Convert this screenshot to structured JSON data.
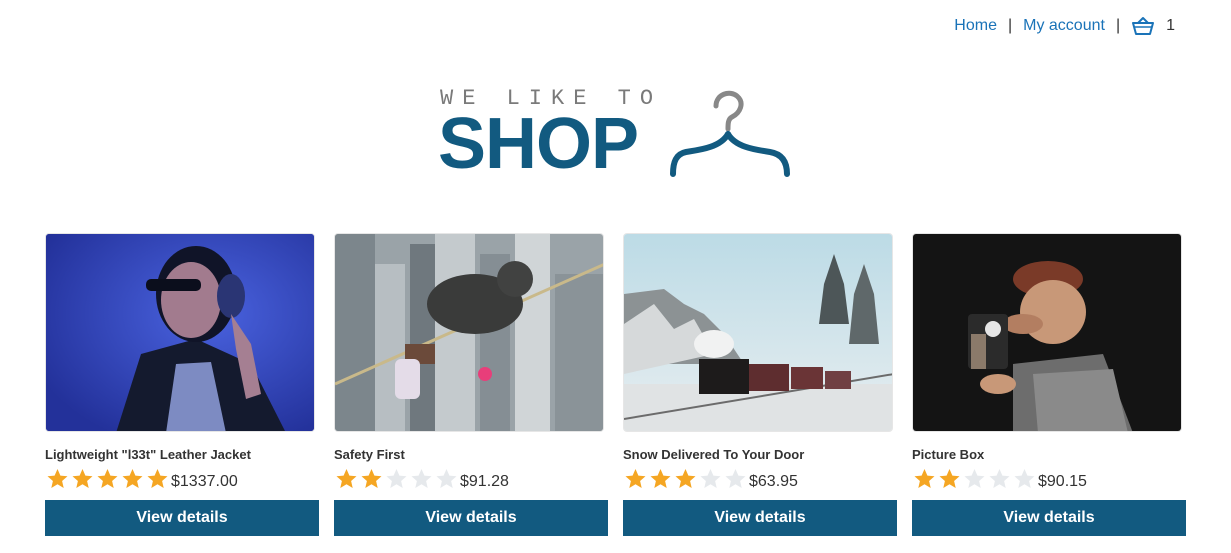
{
  "nav": {
    "home_label": "Home",
    "separator": "|",
    "account_label": "My account",
    "cart_icon": "basket-icon",
    "cart_count": "1"
  },
  "logo": {
    "tagline": "WE LIKE TO",
    "wordmark": "SHOP",
    "icon": "hanger-icon"
  },
  "colors": {
    "brand": "#125a80",
    "link": "#1a73b8",
    "star_filled": "#f5a623",
    "star_empty": "#e6e9ec"
  },
  "products": [
    {
      "title": "Lightweight \"l33t\" Leather Jacket",
      "rating": 5,
      "max_rating": 5,
      "price": "$1337.00",
      "button_label": "View details",
      "image": "woman-with-headphones-photo"
    },
    {
      "title": "Safety First",
      "rating": 2,
      "max_rating": 5,
      "price": "$91.28",
      "button_label": "View details",
      "image": "child-on-tightrope-over-city-photo"
    },
    {
      "title": "Snow Delivered To Your Door",
      "rating": 3,
      "max_rating": 5,
      "price": "$63.95",
      "button_label": "View details",
      "image": "steam-train-in-snow-photo"
    },
    {
      "title": "Picture Box",
      "rating": 2,
      "max_rating": 5,
      "price": "$90.15",
      "button_label": "View details",
      "image": "caricature-photographer-figurine-photo"
    }
  ]
}
